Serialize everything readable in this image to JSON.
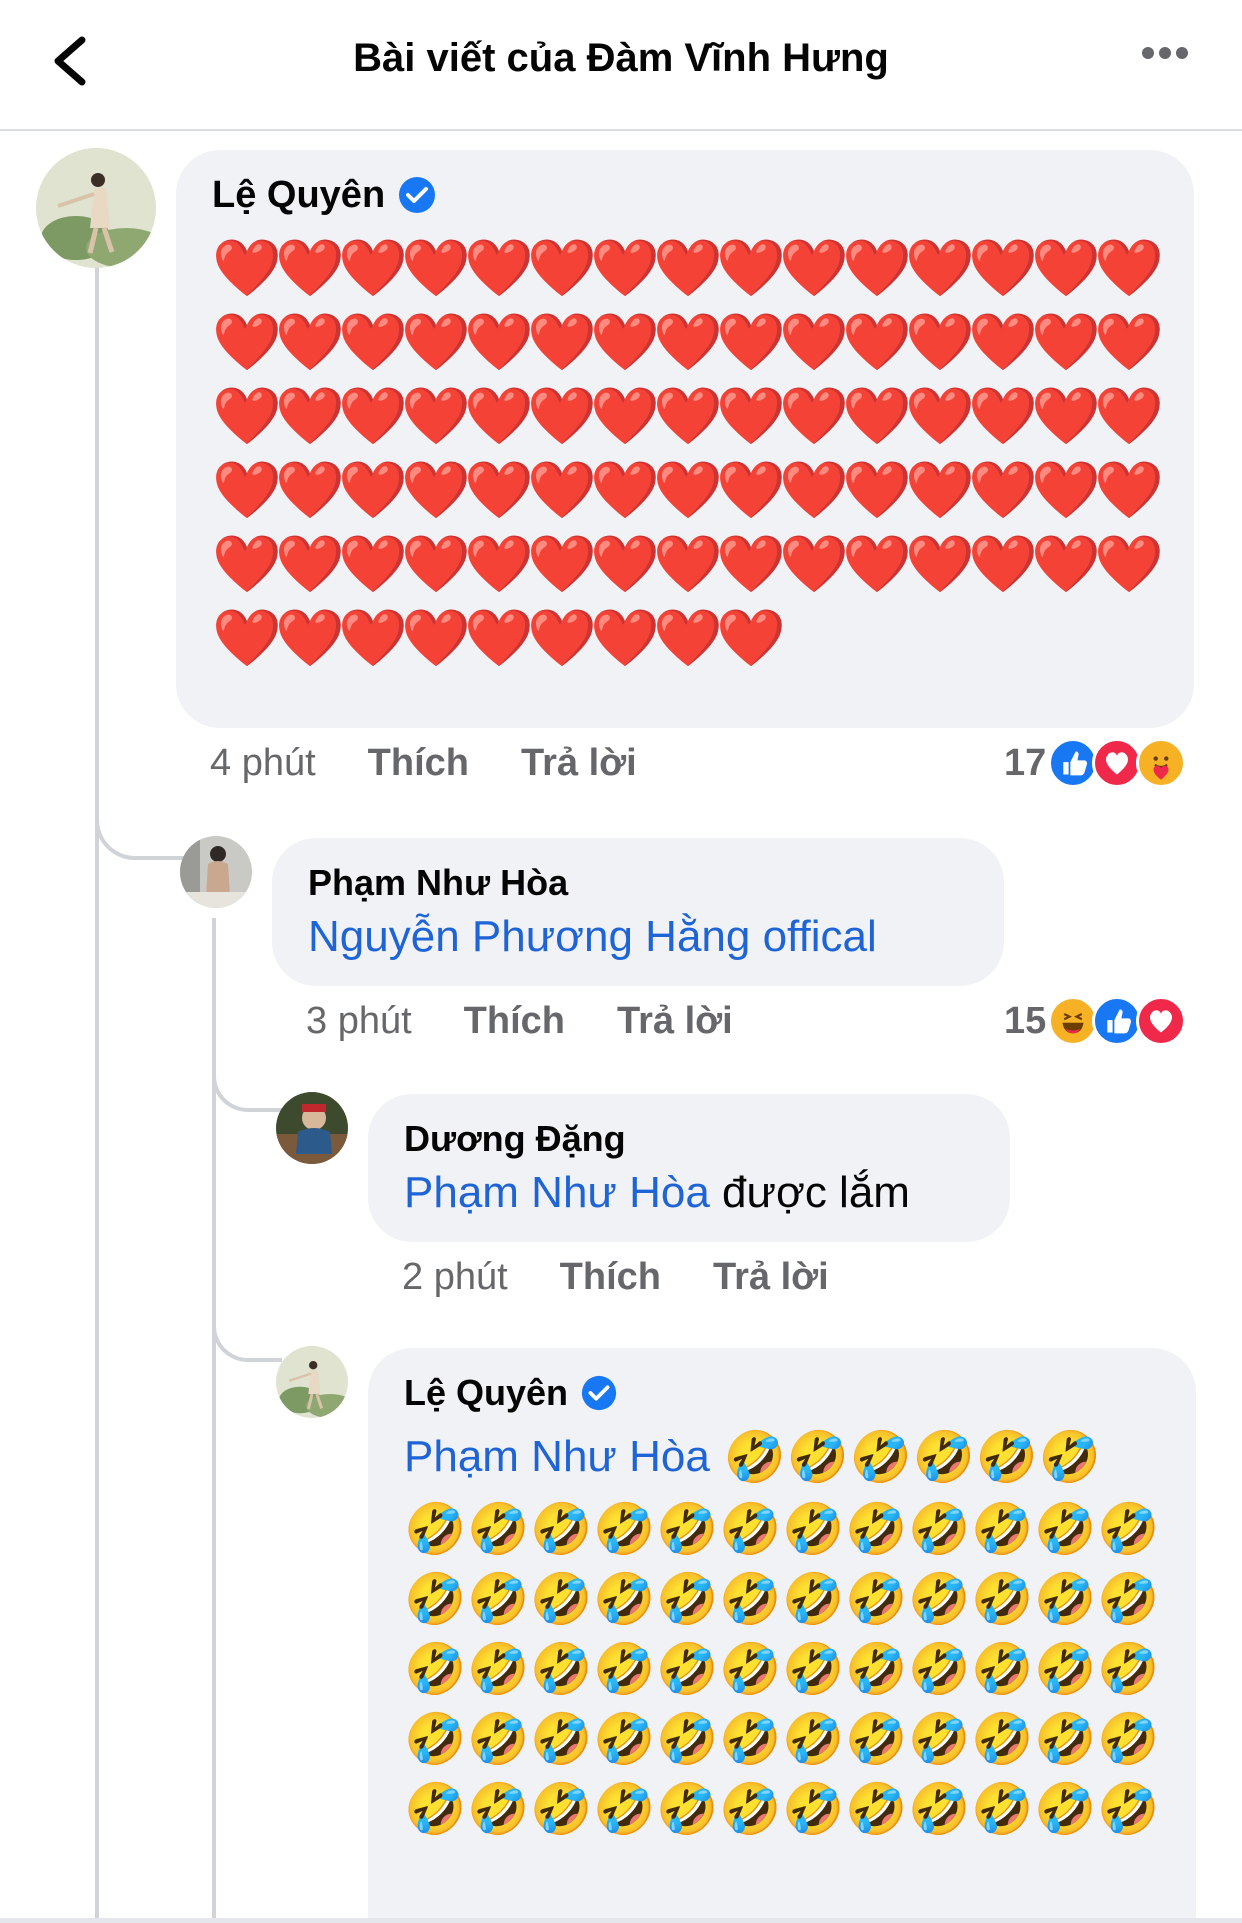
{
  "header": {
    "title": "Bài viết của Đàm Vĩnh Hưng"
  },
  "comments": [
    {
      "author": "Lệ Quyên",
      "verified": true,
      "emoji": "❤️",
      "emoji_count": 84,
      "time": "4 phút",
      "like_label": "Thích",
      "reply_label": "Trả lời",
      "reaction_count": "17",
      "reaction_icons": [
        "like-reaction-icon",
        "love-reaction-icon",
        "care-reaction-icon"
      ]
    },
    {
      "author": "Phạm Như Hòa",
      "mention": "Nguyễn Phương Hằng offical",
      "time": "3 phút",
      "like_label": "Thích",
      "reply_label": "Trả lời",
      "reaction_count": "15",
      "reaction_icons": [
        "haha-reaction-icon",
        "like-reaction-icon",
        "love-reaction-icon"
      ]
    },
    {
      "author": "Dương Đặng",
      "mention": "Phạm Như Hòa",
      "text": "được lắm",
      "time": "2 phút",
      "like_label": "Thích",
      "reply_label": "Trả lời"
    },
    {
      "author": "Lệ Quyên",
      "verified": true,
      "mention": "Phạm Như Hòa",
      "emoji": "🤣",
      "emoji_count_first_line": 6,
      "emoji_count": 66
    }
  ],
  "colors": {
    "mention": "#1f64d6",
    "bubble": "#f0f2f5",
    "meta": "#65676b",
    "verified": "#1877f2"
  }
}
